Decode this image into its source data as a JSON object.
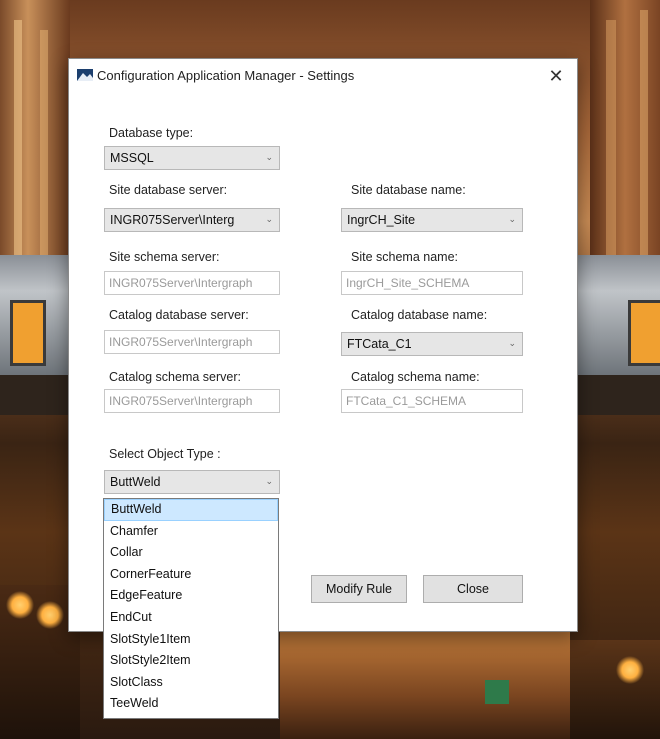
{
  "window": {
    "title": "Configuration Application Manager - Settings",
    "close_glyph": "✕"
  },
  "form": {
    "database_type": {
      "label": "Database type:",
      "value": "MSSQL"
    },
    "site_db_server": {
      "label": "Site database server:",
      "value": "INGR075Server\\Interg"
    },
    "site_db_name": {
      "label": "Site database name:",
      "value": "IngrCH_Site"
    },
    "site_schema_server": {
      "label": "Site schema server:",
      "value": "INGR075Server\\Intergraph"
    },
    "site_schema_name": {
      "label": "Site schema name:",
      "value": "IngrCH_Site_SCHEMA"
    },
    "catalog_db_server": {
      "label": "Catalog database server:",
      "value": "INGR075Server\\Intergraph"
    },
    "catalog_db_name": {
      "label": "Catalog database name:",
      "value": "FTCata_C1"
    },
    "catalog_schema_server": {
      "label": "Catalog schema server:",
      "value": "INGR075Server\\Intergraph"
    },
    "catalog_schema_name": {
      "label": "Catalog schema name:",
      "value": "FTCata_C1_SCHEMA"
    },
    "object_type": {
      "label": "Select Object Type :",
      "value": "ButtWeld"
    }
  },
  "dropdown": {
    "options": [
      "ButtWeld",
      "Chamfer",
      "Collar",
      "CornerFeature",
      "EdgeFeature",
      "EndCut",
      "SlotStyle1Item",
      "SlotStyle2Item",
      "SlotClass",
      "TeeWeld"
    ],
    "selected_index": 0
  },
  "buttons": {
    "modify_rule": "Modify Rule",
    "close": "Close"
  },
  "icons": {
    "combo_arrow": "⌄"
  },
  "colors": {
    "selected_bg": "#cde8ff",
    "combo_bg": "#e6e6e6"
  }
}
